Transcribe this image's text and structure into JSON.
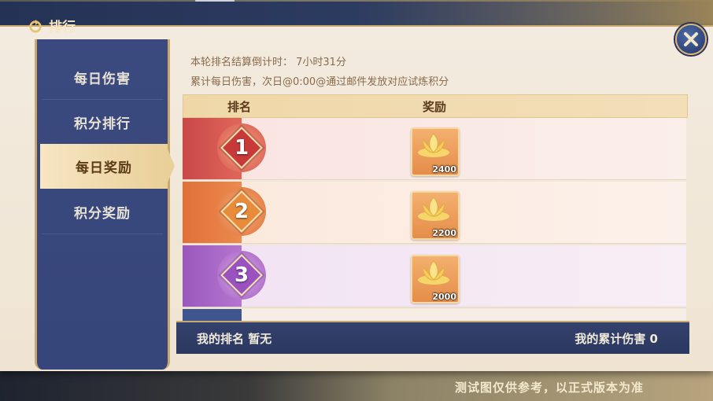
{
  "header": {
    "title": "排行"
  },
  "sidebar": {
    "items": [
      {
        "label": "每日伤害",
        "active": false
      },
      {
        "label": "积分排行",
        "active": false
      },
      {
        "label": "每日奖励",
        "active": true
      },
      {
        "label": "积分奖励",
        "active": false
      }
    ]
  },
  "info": {
    "countdown": "本轮排名结算倒计时： 7小时31分",
    "note": "累计每日伤害，次日@0:00@通过邮件发放对应试炼积分"
  },
  "table": {
    "headers": {
      "rank": "排名",
      "reward": "奖励"
    },
    "rows": [
      {
        "rank": "1",
        "reward_icon": "golden-lotus-icon",
        "reward_count": "2400",
        "color": "#d9564f"
      },
      {
        "rank": "2",
        "reward_icon": "golden-lotus-icon",
        "reward_count": "2200",
        "color": "#e0713a"
      },
      {
        "rank": "3",
        "reward_icon": "golden-lotus-icon",
        "reward_count": "2000",
        "color": "#a561c2"
      }
    ]
  },
  "footer": {
    "my_rank": "我的排名 暂无",
    "my_damage": "我的累计伤害 0"
  },
  "disclaimer": "测试图仅供参考，以正式版本为准",
  "colors": {
    "accent_gold": "#c9a970",
    "panel_navy": "#36457a"
  }
}
